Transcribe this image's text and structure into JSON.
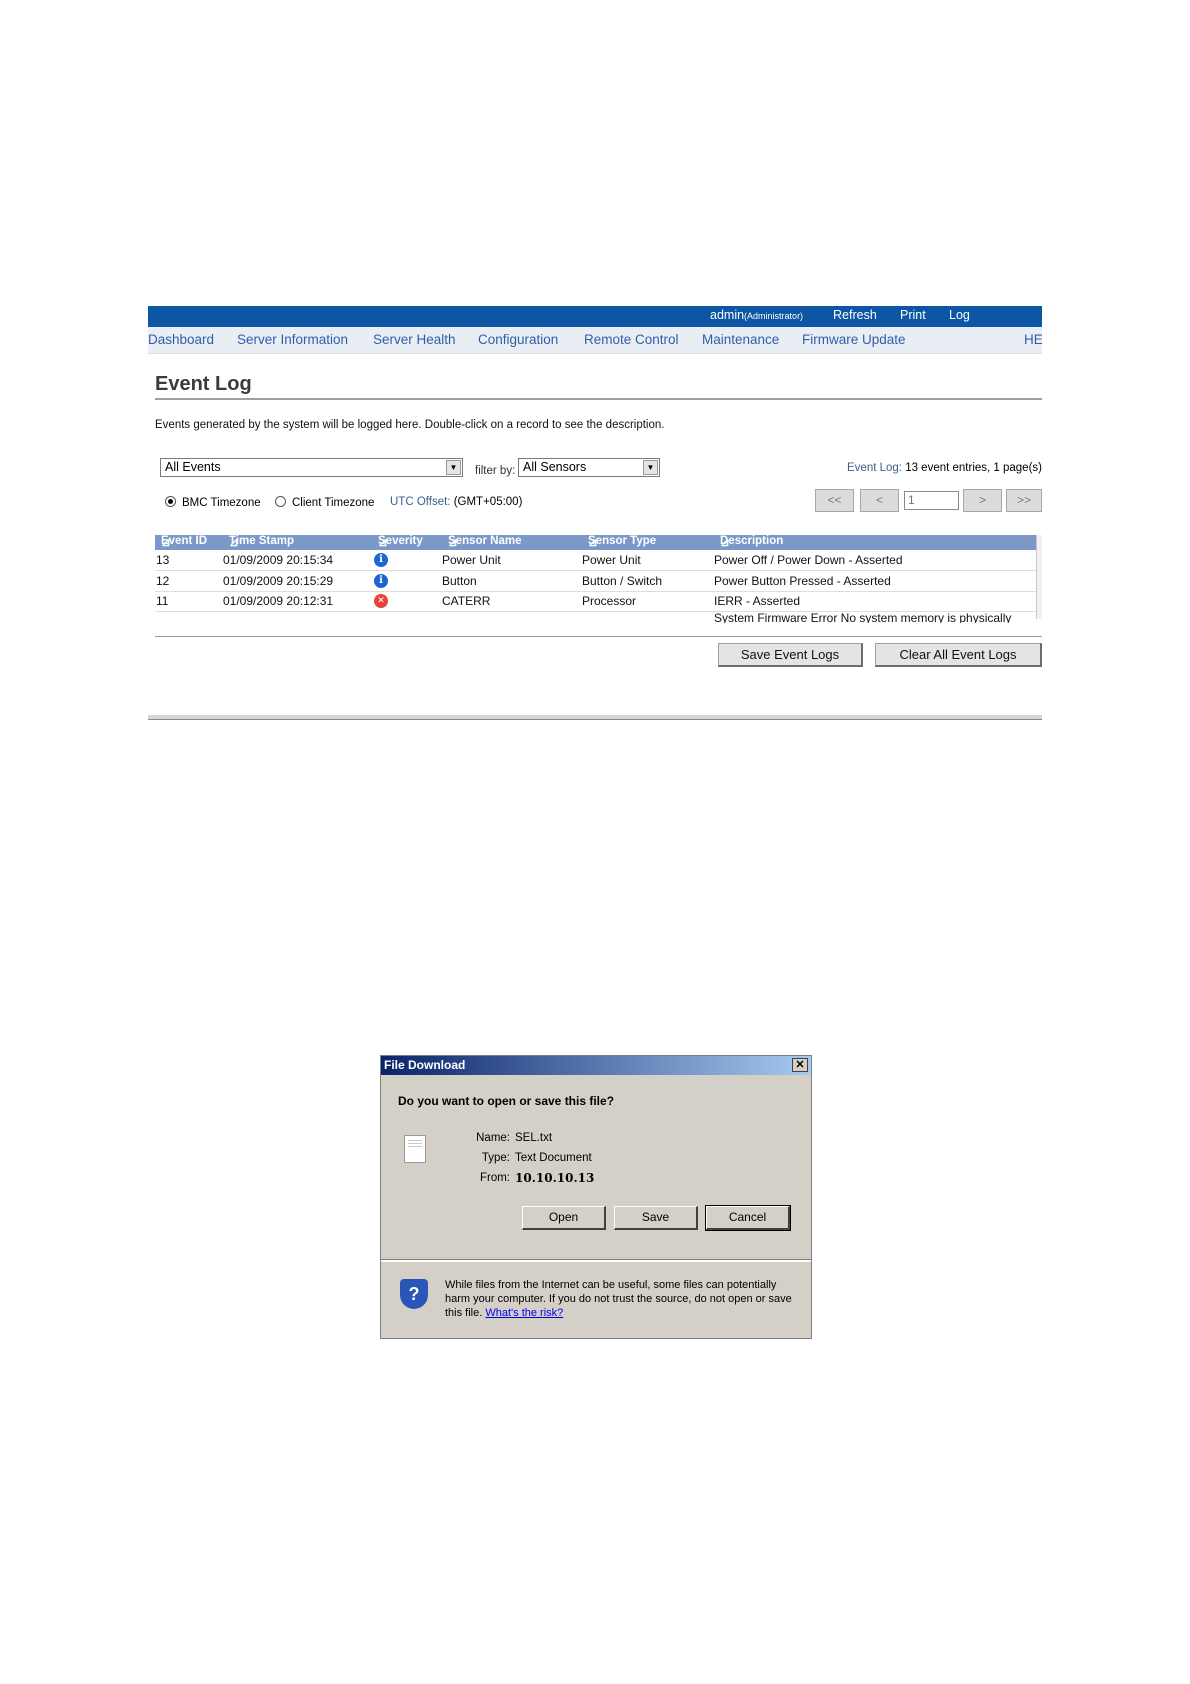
{
  "topbar": {
    "user": "admin",
    "role": "(Administrator)",
    "refresh": "Refresh",
    "print": "Print",
    "logout": "Log"
  },
  "nav": {
    "items": [
      "Dashboard",
      "Server Information",
      "Server Health",
      "Configuration",
      "Remote Control",
      "Maintenance",
      "Firmware Update"
    ],
    "help": "HE"
  },
  "page": {
    "title": "Event Log",
    "intro": "Events generated by the system will be logged here. Double-click on a record to see the description."
  },
  "filters": {
    "events_select": "All Events",
    "filter_by_label": "filter by:",
    "sensors_select": "All Sensors",
    "event_log_label": "Event Log:",
    "event_log_count": "13 event entries, 1 page(s)",
    "bmc_timezone": "BMC Timezone",
    "client_timezone": "Client Timezone",
    "utc_label": "UTC Offset:",
    "utc_value": "(GMT+05:00)",
    "selected_timezone": "BMC Timezone"
  },
  "pager": {
    "first": "<<",
    "prev": "<",
    "page_value": "1",
    "next": ">",
    "last": ">>"
  },
  "table": {
    "headers": [
      "Event ID",
      "Time Stamp",
      "Severity",
      "Sensor Name",
      "Sensor Type",
      "Description"
    ],
    "rows": [
      {
        "id": "13",
        "time": "01/09/2009 20:15:34",
        "severity": "info",
        "sensor": "Power Unit",
        "type": "Power Unit",
        "desc": "Power Off / Power Down - Asserted"
      },
      {
        "id": "12",
        "time": "01/09/2009 20:15:29",
        "severity": "info",
        "sensor": "Button",
        "type": "Button / Switch",
        "desc": "Power Button Pressed - Asserted"
      },
      {
        "id": "11",
        "time": "01/09/2009 20:12:31",
        "severity": "error",
        "sensor": "CATERR",
        "type": "Processor",
        "desc": "IERR - Asserted"
      },
      {
        "desc_partial": "System Firmware Error No system memory is physically"
      }
    ]
  },
  "actions": {
    "save": "Save Event Logs",
    "clear": "Clear All Event Logs"
  },
  "dialog": {
    "title": "File Download",
    "close": "✕",
    "question": "Do you want to open or save this file?",
    "name_label": "Name:",
    "name_value": "SEL.txt",
    "type_label": "Type:",
    "type_value": "Text Document",
    "from_label": "From:",
    "from_value": "10.10.10.13",
    "open": "Open",
    "save": "Save",
    "cancel": "Cancel",
    "warning": "While files from the Internet can be useful, some files can potentially harm your computer. If you do not trust the source, do not open or save this file.",
    "risk_link": "What's the risk?"
  },
  "colors": {
    "topbar": "#0c56a4",
    "nav_text": "#2f5ea8",
    "grid_header": "#7b98c8",
    "dialog_bg": "#d4d0c8"
  },
  "icons": {
    "info": "info-icon",
    "error": "error-icon",
    "sort": "sort-arrow-icon",
    "file": "text-file-icon",
    "shield": "security-shield-icon"
  }
}
